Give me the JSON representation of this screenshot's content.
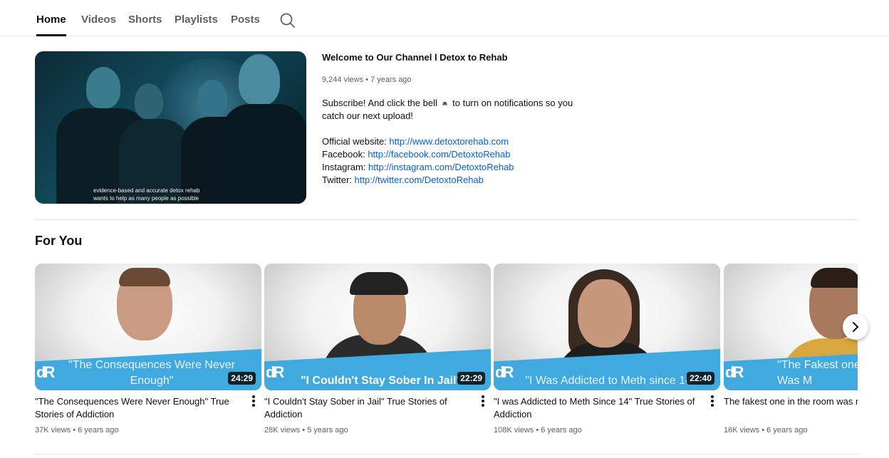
{
  "tabs": [
    {
      "label": "Home",
      "active": true
    },
    {
      "label": "Videos"
    },
    {
      "label": "Shorts"
    },
    {
      "label": "Playlists"
    },
    {
      "label": "Posts"
    }
  ],
  "featured": {
    "title": "Welcome to Our Channel l Detox to Rehab",
    "views": "9,244 views",
    "age": "7 years ago",
    "description_1": "Subscribe! And click the bell",
    "bell_icon": "bell-icon",
    "description_2": "to turn on notifications so you catch our next upload!",
    "caption_line_1": "evidence-based and accurate detox rehab",
    "caption_line_2": "wants to help as many people as possible",
    "links": [
      {
        "label": "Official website:",
        "url": "http://www.detoxtorehab.com"
      },
      {
        "label": "Facebook:",
        "url": "http://facebook.com/DetoxtoRehab"
      },
      {
        "label": "Instagram:",
        "url": "http://instagram.com/DetoxtoRehab"
      },
      {
        "label": "Twitter:",
        "url": "http://twitter.com/DetoxtoRehab"
      }
    ]
  },
  "shelf": {
    "title": "For You",
    "videos": [
      {
        "thumb_text": "\"The Consequences Were Never Enough\"",
        "duration": "24:29",
        "title": "\"The Consequences Were Never Enough\" True Stories of Addiction",
        "views": "37K views",
        "age": "6 years ago"
      },
      {
        "thumb_text": "\"I Couldn't Stay Sober In Jail\"",
        "duration": "22:29",
        "title": "\"I Couldn't Stay Sober in Jail\" True Stories of Addiction",
        "views": "28K views",
        "age": "5 years ago"
      },
      {
        "thumb_text": "\"I Was Addicted to Meth since 14\"",
        "duration": "22:40",
        "title": "\"I was Addicted to Meth Since 14\" True Stories of Addiction",
        "views": "108K views",
        "age": "6 years ago"
      },
      {
        "thumb_text": "\"The Fakest one Room Was M",
        "duration": "",
        "title": "The fakest one in the room was m Addiction",
        "views": "16K views",
        "age": "6 years ago"
      }
    ]
  },
  "colors": {
    "link": "#065fd4",
    "banner": "#3fa9e0",
    "text_secondary": "#606060"
  }
}
